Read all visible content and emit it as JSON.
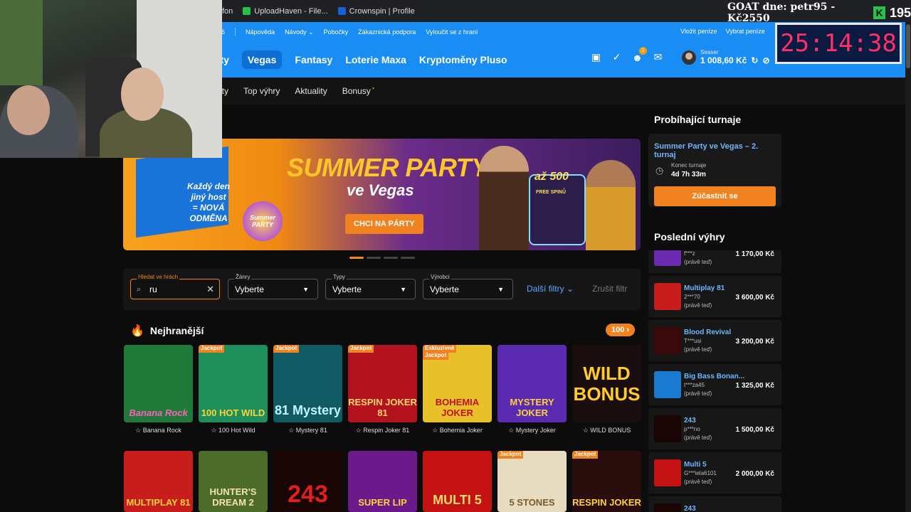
{
  "bookmarks": [
    {
      "label": "fon",
      "color": "#888"
    },
    {
      "label": "UploadHaven - File...",
      "color": "#27c24c"
    },
    {
      "label": "Crownspin | Profile",
      "color": "#1a5fd4"
    }
  ],
  "overlay": {
    "goat_text": "GOAT dne: petr95 - Kč2550",
    "k_letter": "K",
    "k_count": "195",
    "timer": "25:14:38"
  },
  "util": {
    "left_num": "46",
    "help": "Nápověda",
    "guides": "Návody",
    "branches": "Pobočky",
    "support": "Zákaznická podpora",
    "exclude": "Vyloučit se z hraní",
    "deposit": "Vložit peníze",
    "withdraw": "Vybrat peníze"
  },
  "nav": {
    "items": [
      "rty",
      "Vegas",
      "Fantasy",
      "Loterie Maxa",
      "Kryptoměny Pluso"
    ],
    "active_index": 1,
    "notif_count": "3"
  },
  "user": {
    "name": "Seaser",
    "balance": "1 008,60 Kč"
  },
  "subnav": {
    "items": [
      "oty",
      "Top výhry",
      "Aktuality"
    ],
    "bonus": "Bonusy",
    "bonus_sup": "*"
  },
  "banner": {
    "left_text_1": "Každý den",
    "left_text_2": "jiný host",
    "left_text_3": "= NOVÁ",
    "left_text_4": "ODMĚNA",
    "logo": "Summer PARTY",
    "title": "SUMMER PARTY",
    "subtitle": "ve Vegas",
    "cta": "CHCI NA PÁRTY",
    "badge_amount": "až 500",
    "badge_text": "FREE SPINŮ"
  },
  "filters": {
    "search_label": "Hledat ve hrách",
    "search_value": "ru",
    "genres_label": "Žánry",
    "genres_value": "Vyberte",
    "types_label": "Typy",
    "types_value": "Vyberte",
    "makers_label": "Výrobci",
    "makers_value": "Vyberte",
    "more": "Další filtry",
    "cancel": "Zrušit filtr"
  },
  "hottest": {
    "title": "Nejhranější",
    "count": "100",
    "games": [
      {
        "name": "Banana Rock",
        "art": "Banana Rock",
        "tag": "",
        "tag2": "",
        "bg": "#1f7a3a"
      },
      {
        "name": "100 Hot Wild",
        "art": "100 HOT WILD",
        "tag": "Jackpot",
        "tag2": "",
        "bg": "#1e8f5a"
      },
      {
        "name": "Mystery 81",
        "art": "81 Mystery",
        "tag": "Jackpot",
        "tag2": "",
        "bg": "#0f5a63"
      },
      {
        "name": "Respin Joker 81",
        "art": "RESPIN JOKER 81",
        "tag": "Jackpot",
        "tag2": "",
        "bg": "#b3121f"
      },
      {
        "name": "Bohemia Joker",
        "art": "BOHEMIA JOKER",
        "tag": "Exkluzivně",
        "tag2": "Jackpot",
        "bg": "#e8c02a"
      },
      {
        "name": "Mystery Joker",
        "art": "MYSTERY JOKER",
        "tag": "",
        "tag2": "",
        "bg": "#5a2bb0"
      },
      {
        "name": "WILD BONUS",
        "art": "WILD BONUS",
        "tag": "",
        "tag2": "",
        "bg": "#1a0d0d"
      }
    ],
    "row2": [
      {
        "art": "MULTIPLAY 81",
        "tag": "",
        "bg": "#c81d1d"
      },
      {
        "art": "HUNTER'S DREAM 2",
        "tag": "",
        "bg": "#4d6b2a"
      },
      {
        "art": "243",
        "tag": "",
        "bg": "#1a0505"
      },
      {
        "art": "SUPER LIP",
        "tag": "",
        "bg": "#6a1a8a"
      },
      {
        "art": "MULTI 5",
        "tag": "",
        "bg": "#c41212"
      },
      {
        "art": "5 STONES",
        "tag": "Jackpot",
        "bg": "#e8dcc0"
      },
      {
        "art": "RESPIN JOKER",
        "tag": "Jackpot",
        "bg": "#2a0d0d"
      }
    ]
  },
  "tournament": {
    "section_title": "Probíhající turnaje",
    "name": "Summer Party ve Vegas – 2. turnaj",
    "end_label": "Konec turnaje",
    "end_value": "4d 7h 33m",
    "join": "Zúčastnit se"
  },
  "last_wins": {
    "title": "Poslední výhry",
    "items": [
      {
        "game": "",
        "user": "f***z",
        "time": "(právě teď)",
        "amount": "1 170,00 Kč",
        "bg": "#6a2bb0"
      },
      {
        "game": "Multiplay 81",
        "user": "2***70",
        "time": "(právě teď)",
        "amount": "3 600,00 Kč",
        "bg": "#c81d1d"
      },
      {
        "game": "Blood Revival",
        "user": "T***usi",
        "time": "(právě teď)",
        "amount": "3 200,00 Kč",
        "bg": "#3a0a0a"
      },
      {
        "game": "Big Bass Bonan...",
        "user": "t***za45",
        "time": "(právě teď)",
        "amount": "1 325,00 Kč",
        "bg": "#1a7ad0"
      },
      {
        "game": "243",
        "user": "p***no",
        "time": "(právě teď)",
        "amount": "1 500,00 Kč",
        "bg": "#1a0505"
      },
      {
        "game": "Multi 5",
        "user": "G***iela6101",
        "time": "(právě teď)",
        "amount": "2 000,00 Kč",
        "bg": "#c41212"
      },
      {
        "game": "243",
        "user": "",
        "time": "",
        "amount": "",
        "bg": "#1a0505"
      }
    ]
  }
}
